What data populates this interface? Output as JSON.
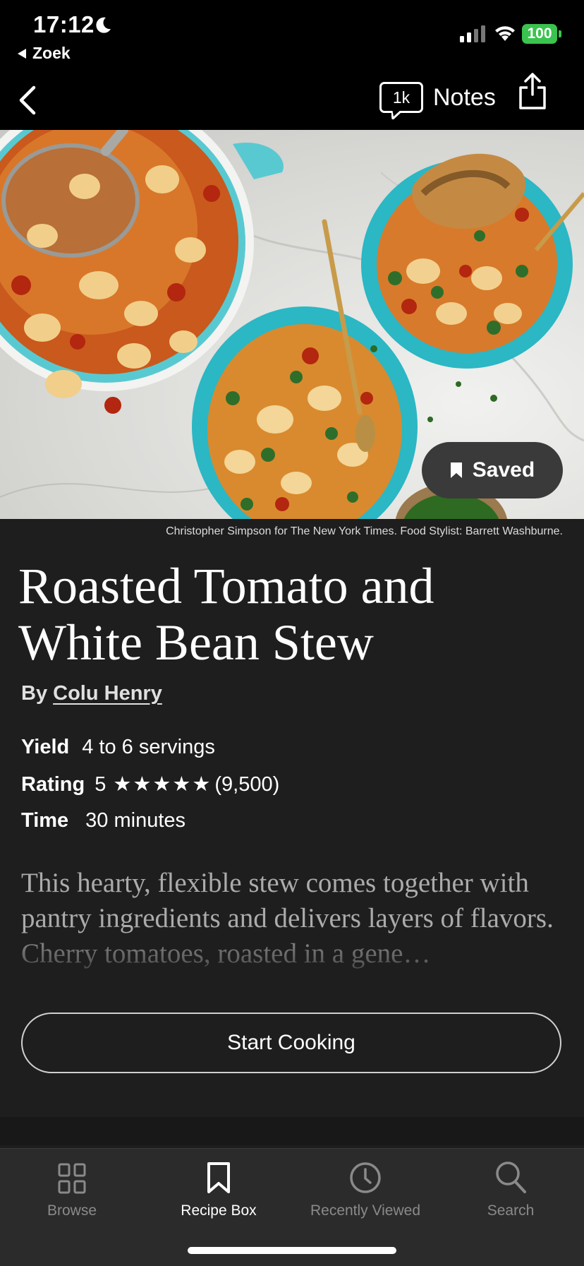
{
  "status_bar": {
    "time": "17:12",
    "back_app": "Zoek",
    "battery": "100"
  },
  "nav": {
    "notes_count": "1k",
    "notes_label": "Notes"
  },
  "hero": {
    "saved_label": "Saved",
    "credit": "Christopher Simpson for The New York Times. Food Stylist: Barrett Washburne."
  },
  "recipe": {
    "title_line1": "Roasted Tomato and",
    "title_line2": "White Bean Stew",
    "by_prefix": "By",
    "author": "Colu Henry",
    "yield_label": "Yield",
    "yield_value": "4 to 6 servings",
    "rating_label": "Rating",
    "rating_value": "5",
    "rating_stars": "★★★★★",
    "rating_count": "(9,500)",
    "time_label": "Time",
    "time_value": "30 minutes",
    "description": "This hearty, flexible stew comes together with pantry ingredients and delivers layers of flavors. Cherry tomatoes, roasted in a gene…",
    "start_cooking": "Start Cooking"
  },
  "tabbar": {
    "tabs": [
      {
        "label": "Browse",
        "icon": "grid-icon"
      },
      {
        "label": "Recipe Box",
        "icon": "bookmark-icon"
      },
      {
        "label": "Recently Viewed",
        "icon": "clock-icon"
      },
      {
        "label": "Search",
        "icon": "search-icon"
      }
    ],
    "active": "Recipe Box"
  },
  "colors": {
    "background": "#1e1e1e",
    "bar": "#000000",
    "battery": "#3ac34e",
    "bowl": "#2bb7c4"
  }
}
